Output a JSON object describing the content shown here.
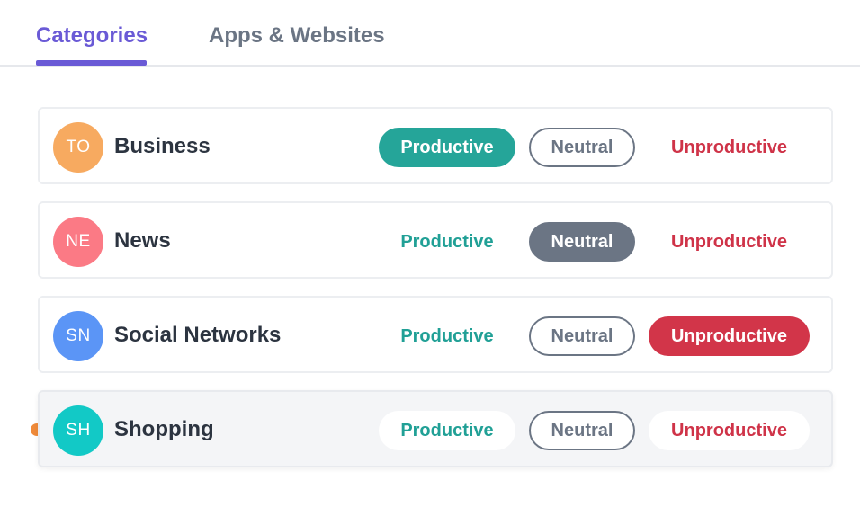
{
  "tabs": {
    "categories": "Categories",
    "apps_websites": "Apps & Websites",
    "active": "Categories"
  },
  "colors": {
    "accent": "#6a5ad6",
    "productive": "#25a599",
    "neutral": "#6b7584",
    "unproductive": "#d23549",
    "indicator_dot": "#ef8a3a"
  },
  "rows": [
    {
      "initials": "TO",
      "label": "Business",
      "avatar_color": "#f7aa60",
      "selected": "Productive",
      "productive": "Productive",
      "neutral": "Neutral",
      "unproductive": "Unproductive"
    },
    {
      "initials": "NE",
      "label": "News",
      "avatar_color": "#fb7a85",
      "selected": "Neutral",
      "productive": "Productive",
      "neutral": "Neutral",
      "unproductive": "Unproductive"
    },
    {
      "initials": "SN",
      "label": "Social Networks",
      "avatar_color": "#5b95f6",
      "selected": "Unproductive",
      "productive": "Productive",
      "neutral": "Neutral",
      "unproductive": "Unproductive"
    },
    {
      "initials": "SH",
      "label": "Shopping",
      "avatar_color": "#12c9c6",
      "selected": "none",
      "productive": "Productive",
      "neutral": "Neutral",
      "unproductive": "Unproductive"
    }
  ]
}
